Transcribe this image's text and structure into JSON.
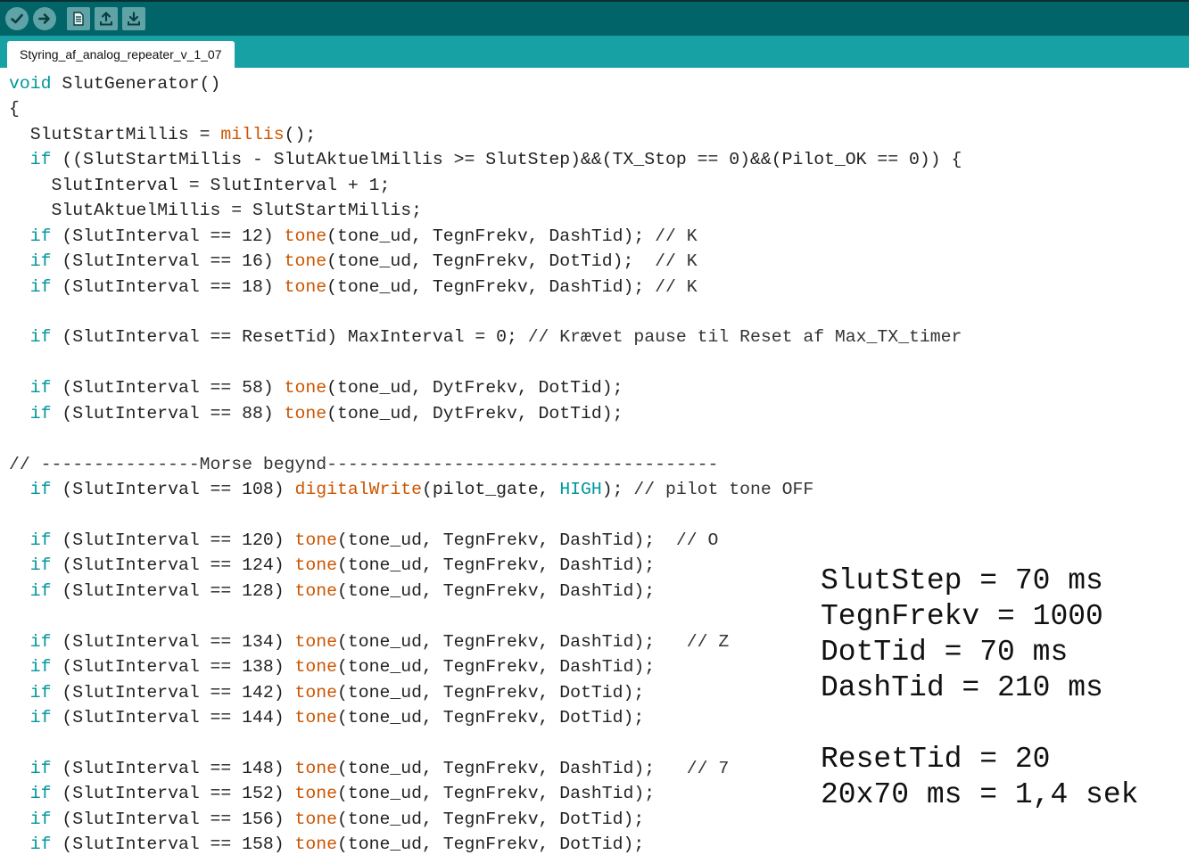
{
  "toolbar": {
    "buttons": [
      {
        "name": "verify-button",
        "icon": "check-icon"
      },
      {
        "name": "upload-button",
        "icon": "arrow-right-icon"
      },
      {
        "name": "new-button",
        "icon": "new-file-icon"
      },
      {
        "name": "open-button",
        "icon": "open-icon"
      },
      {
        "name": "save-button",
        "icon": "save-icon"
      }
    ],
    "colors": {
      "bar": "#006468",
      "button": "#5fa3a7",
      "tabbar": "#17a1a5"
    }
  },
  "tab": {
    "label": "Styring_af_analog_repeater_v_1_07"
  },
  "code_lines": [
    [
      {
        "t": "void",
        "c": "kw"
      },
      {
        "t": " SlutGenerator()",
        "c": "plain"
      }
    ],
    [
      {
        "t": "{",
        "c": "plain"
      }
    ],
    [
      {
        "t": "  SlutStartMillis = ",
        "c": "plain"
      },
      {
        "t": "millis",
        "c": "fn"
      },
      {
        "t": "();",
        "c": "plain"
      }
    ],
    [
      {
        "t": "  ",
        "c": "plain"
      },
      {
        "t": "if",
        "c": "kw"
      },
      {
        "t": " ((SlutStartMillis - SlutAktuelMillis >= SlutStep)&&(TX_Stop == 0)&&(Pilot_OK == 0)) {",
        "c": "plain"
      }
    ],
    [
      {
        "t": "    SlutInterval = SlutInterval + 1;",
        "c": "plain"
      }
    ],
    [
      {
        "t": "    SlutAktuelMillis = SlutStartMillis;",
        "c": "plain"
      }
    ],
    [
      {
        "t": "  ",
        "c": "plain"
      },
      {
        "t": "if",
        "c": "kw"
      },
      {
        "t": " (SlutInterval == 12) ",
        "c": "plain"
      },
      {
        "t": "tone",
        "c": "fn"
      },
      {
        "t": "(tone_ud, TegnFrekv, DashTid); ",
        "c": "plain"
      },
      {
        "t": "// K",
        "c": "cm"
      }
    ],
    [
      {
        "t": "  ",
        "c": "plain"
      },
      {
        "t": "if",
        "c": "kw"
      },
      {
        "t": " (SlutInterval == 16) ",
        "c": "plain"
      },
      {
        "t": "tone",
        "c": "fn"
      },
      {
        "t": "(tone_ud, TegnFrekv, DotTid);  ",
        "c": "plain"
      },
      {
        "t": "// K",
        "c": "cm"
      }
    ],
    [
      {
        "t": "  ",
        "c": "plain"
      },
      {
        "t": "if",
        "c": "kw"
      },
      {
        "t": " (SlutInterval == 18) ",
        "c": "plain"
      },
      {
        "t": "tone",
        "c": "fn"
      },
      {
        "t": "(tone_ud, TegnFrekv, DashTid); ",
        "c": "plain"
      },
      {
        "t": "// K",
        "c": "cm"
      }
    ],
    [],
    [
      {
        "t": "  ",
        "c": "plain"
      },
      {
        "t": "if",
        "c": "kw"
      },
      {
        "t": " (SlutInterval == ResetTid) MaxInterval = 0; ",
        "c": "plain"
      },
      {
        "t": "// Krævet pause til Reset af Max_TX_timer",
        "c": "cm"
      }
    ],
    [],
    [
      {
        "t": "  ",
        "c": "plain"
      },
      {
        "t": "if",
        "c": "kw"
      },
      {
        "t": " (SlutInterval == 58) ",
        "c": "plain"
      },
      {
        "t": "tone",
        "c": "fn"
      },
      {
        "t": "(tone_ud, DytFrekv, DotTid);",
        "c": "plain"
      }
    ],
    [
      {
        "t": "  ",
        "c": "plain"
      },
      {
        "t": "if",
        "c": "kw"
      },
      {
        "t": " (SlutInterval == 88) ",
        "c": "plain"
      },
      {
        "t": "tone",
        "c": "fn"
      },
      {
        "t": "(tone_ud, DytFrekv, DotTid);",
        "c": "plain"
      }
    ],
    [],
    [
      {
        "t": "// ---------------Morse begynd-------------------------------------",
        "c": "cm"
      }
    ],
    [
      {
        "t": "  ",
        "c": "plain"
      },
      {
        "t": "if",
        "c": "kw"
      },
      {
        "t": " (SlutInterval == 108) ",
        "c": "plain"
      },
      {
        "t": "digitalWrite",
        "c": "fn"
      },
      {
        "t": "(pilot_gate, ",
        "c": "plain"
      },
      {
        "t": "HIGH",
        "c": "const"
      },
      {
        "t": "); ",
        "c": "plain"
      },
      {
        "t": "// pilot tone OFF",
        "c": "cm"
      }
    ],
    [],
    [
      {
        "t": "  ",
        "c": "plain"
      },
      {
        "t": "if",
        "c": "kw"
      },
      {
        "t": " (SlutInterval == 120) ",
        "c": "plain"
      },
      {
        "t": "tone",
        "c": "fn"
      },
      {
        "t": "(tone_ud, TegnFrekv, DashTid);  ",
        "c": "plain"
      },
      {
        "t": "// O",
        "c": "cm"
      }
    ],
    [
      {
        "t": "  ",
        "c": "plain"
      },
      {
        "t": "if",
        "c": "kw"
      },
      {
        "t": " (SlutInterval == 124) ",
        "c": "plain"
      },
      {
        "t": "tone",
        "c": "fn"
      },
      {
        "t": "(tone_ud, TegnFrekv, DashTid);",
        "c": "plain"
      }
    ],
    [
      {
        "t": "  ",
        "c": "plain"
      },
      {
        "t": "if",
        "c": "kw"
      },
      {
        "t": " (SlutInterval == 128) ",
        "c": "plain"
      },
      {
        "t": "tone",
        "c": "fn"
      },
      {
        "t": "(tone_ud, TegnFrekv, DashTid);",
        "c": "plain"
      }
    ],
    [],
    [
      {
        "t": "  ",
        "c": "plain"
      },
      {
        "t": "if",
        "c": "kw"
      },
      {
        "t": " (SlutInterval == 134) ",
        "c": "plain"
      },
      {
        "t": "tone",
        "c": "fn"
      },
      {
        "t": "(tone_ud, TegnFrekv, DashTid);   ",
        "c": "plain"
      },
      {
        "t": "// Z",
        "c": "cm"
      }
    ],
    [
      {
        "t": "  ",
        "c": "plain"
      },
      {
        "t": "if",
        "c": "kw"
      },
      {
        "t": " (SlutInterval == 138) ",
        "c": "plain"
      },
      {
        "t": "tone",
        "c": "fn"
      },
      {
        "t": "(tone_ud, TegnFrekv, DashTid);",
        "c": "plain"
      }
    ],
    [
      {
        "t": "  ",
        "c": "plain"
      },
      {
        "t": "if",
        "c": "kw"
      },
      {
        "t": " (SlutInterval == 142) ",
        "c": "plain"
      },
      {
        "t": "tone",
        "c": "fn"
      },
      {
        "t": "(tone_ud, TegnFrekv, DotTid);",
        "c": "plain"
      }
    ],
    [
      {
        "t": "  ",
        "c": "plain"
      },
      {
        "t": "if",
        "c": "kw"
      },
      {
        "t": " (SlutInterval == 144) ",
        "c": "plain"
      },
      {
        "t": "tone",
        "c": "fn"
      },
      {
        "t": "(tone_ud, TegnFrekv, DotTid);",
        "c": "plain"
      }
    ],
    [],
    [
      {
        "t": "  ",
        "c": "plain"
      },
      {
        "t": "if",
        "c": "kw"
      },
      {
        "t": " (SlutInterval == 148) ",
        "c": "plain"
      },
      {
        "t": "tone",
        "c": "fn"
      },
      {
        "t": "(tone_ud, TegnFrekv, DashTid);   ",
        "c": "plain"
      },
      {
        "t": "// 7",
        "c": "cm"
      }
    ],
    [
      {
        "t": "  ",
        "c": "plain"
      },
      {
        "t": "if",
        "c": "kw"
      },
      {
        "t": " (SlutInterval == 152) ",
        "c": "plain"
      },
      {
        "t": "tone",
        "c": "fn"
      },
      {
        "t": "(tone_ud, TegnFrekv, DashTid);",
        "c": "plain"
      }
    ],
    [
      {
        "t": "  ",
        "c": "plain"
      },
      {
        "t": "if",
        "c": "kw"
      },
      {
        "t": " (SlutInterval == 156) ",
        "c": "plain"
      },
      {
        "t": "tone",
        "c": "fn"
      },
      {
        "t": "(tone_ud, TegnFrekv, DotTid);",
        "c": "plain"
      }
    ],
    [
      {
        "t": "  ",
        "c": "plain"
      },
      {
        "t": "if",
        "c": "kw"
      },
      {
        "t": " (SlutInterval == 158) ",
        "c": "plain"
      },
      {
        "t": "tone",
        "c": "fn"
      },
      {
        "t": "(tone_ud, TegnFrekv, DotTid);",
        "c": "plain"
      }
    ]
  ],
  "notes": {
    "lines": [
      "SlutStep = 70 ms",
      "TegnFrekv = 1000",
      "DotTid = 70 ms",
      "DashTid = 210 ms",
      "",
      "ResetTid = 20",
      "20x70 ms = 1,4 sek"
    ]
  }
}
